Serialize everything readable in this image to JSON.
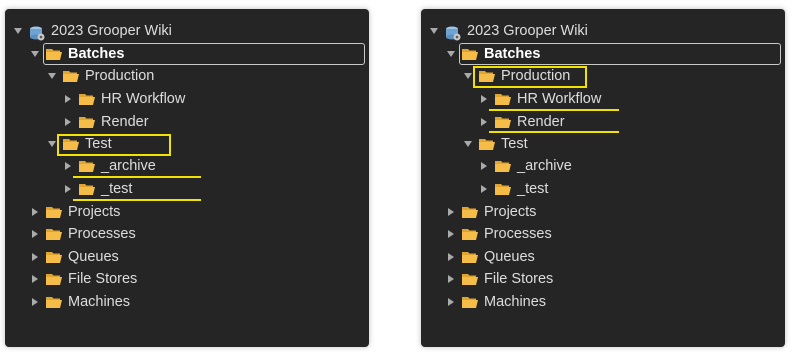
{
  "colors": {
    "panel_bg": "#252525",
    "text": "#dddddd",
    "folder": "#f2b73d",
    "highlight": "#f2e200",
    "selection_border": "#c9c9c9"
  },
  "icons": {
    "root": "database-gear-icon",
    "folder": "folder-open-icon",
    "expand": "triangle-right-icon",
    "collapse": "triangle-down-icon"
  },
  "left_tree": {
    "root": "2023 Grooper Wiki",
    "batches": "Batches",
    "production": "Production",
    "hr_workflow": "HR Workflow",
    "render": "Render",
    "test": "Test",
    "archive": "_archive",
    "test_sub": "_test",
    "projects": "Projects",
    "processes": "Processes",
    "queues": "Queues",
    "file_stores": "File Stores",
    "machines": "Machines"
  },
  "right_tree": {
    "root": "2023 Grooper Wiki",
    "batches": "Batches",
    "production": "Production",
    "hr_workflow": "HR Workflow",
    "render": "Render",
    "test": "Test",
    "archive": "_archive",
    "test_sub": "_test",
    "projects": "Projects",
    "processes": "Processes",
    "queues": "Queues",
    "file_stores": "File Stores",
    "machines": "Machines"
  }
}
